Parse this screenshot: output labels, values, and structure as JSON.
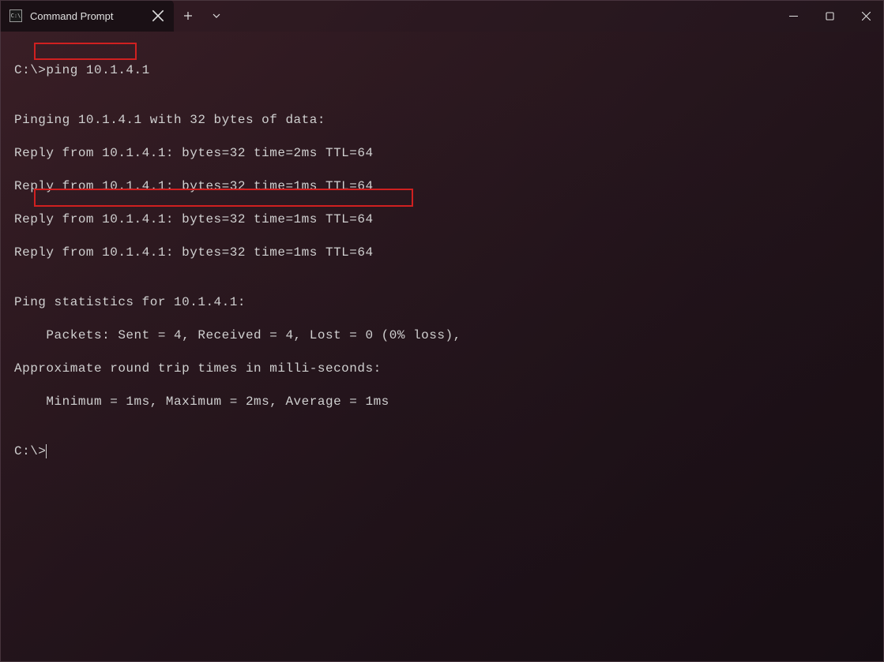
{
  "tab": {
    "title": "Command Prompt",
    "icon_text": "C:\\"
  },
  "terminal": {
    "prompt1_prefix": "C:\\>",
    "command": "ping 10.1.4.1",
    "blank1": "",
    "pinging": "Pinging 10.1.4.1 with 32 bytes of data:",
    "reply1": "Reply from 10.1.4.1: bytes=32 time=2ms TTL=64",
    "reply2": "Reply from 10.1.4.1: bytes=32 time=1ms TTL=64",
    "reply3": "Reply from 10.1.4.1: bytes=32 time=1ms TTL=64",
    "reply4": "Reply from 10.1.4.1: bytes=32 time=1ms TTL=64",
    "blank2": "",
    "stats_header": "Ping statistics for 10.1.4.1:",
    "packets": "    Packets: Sent = 4, Received = 4, Lost = 0 (0% loss),",
    "approx": "Approximate round trip times in milli-seconds:",
    "minmax": "    Minimum = 1ms, Maximum = 2ms, Average = 1ms",
    "blank3": "",
    "prompt2": "C:\\>"
  }
}
